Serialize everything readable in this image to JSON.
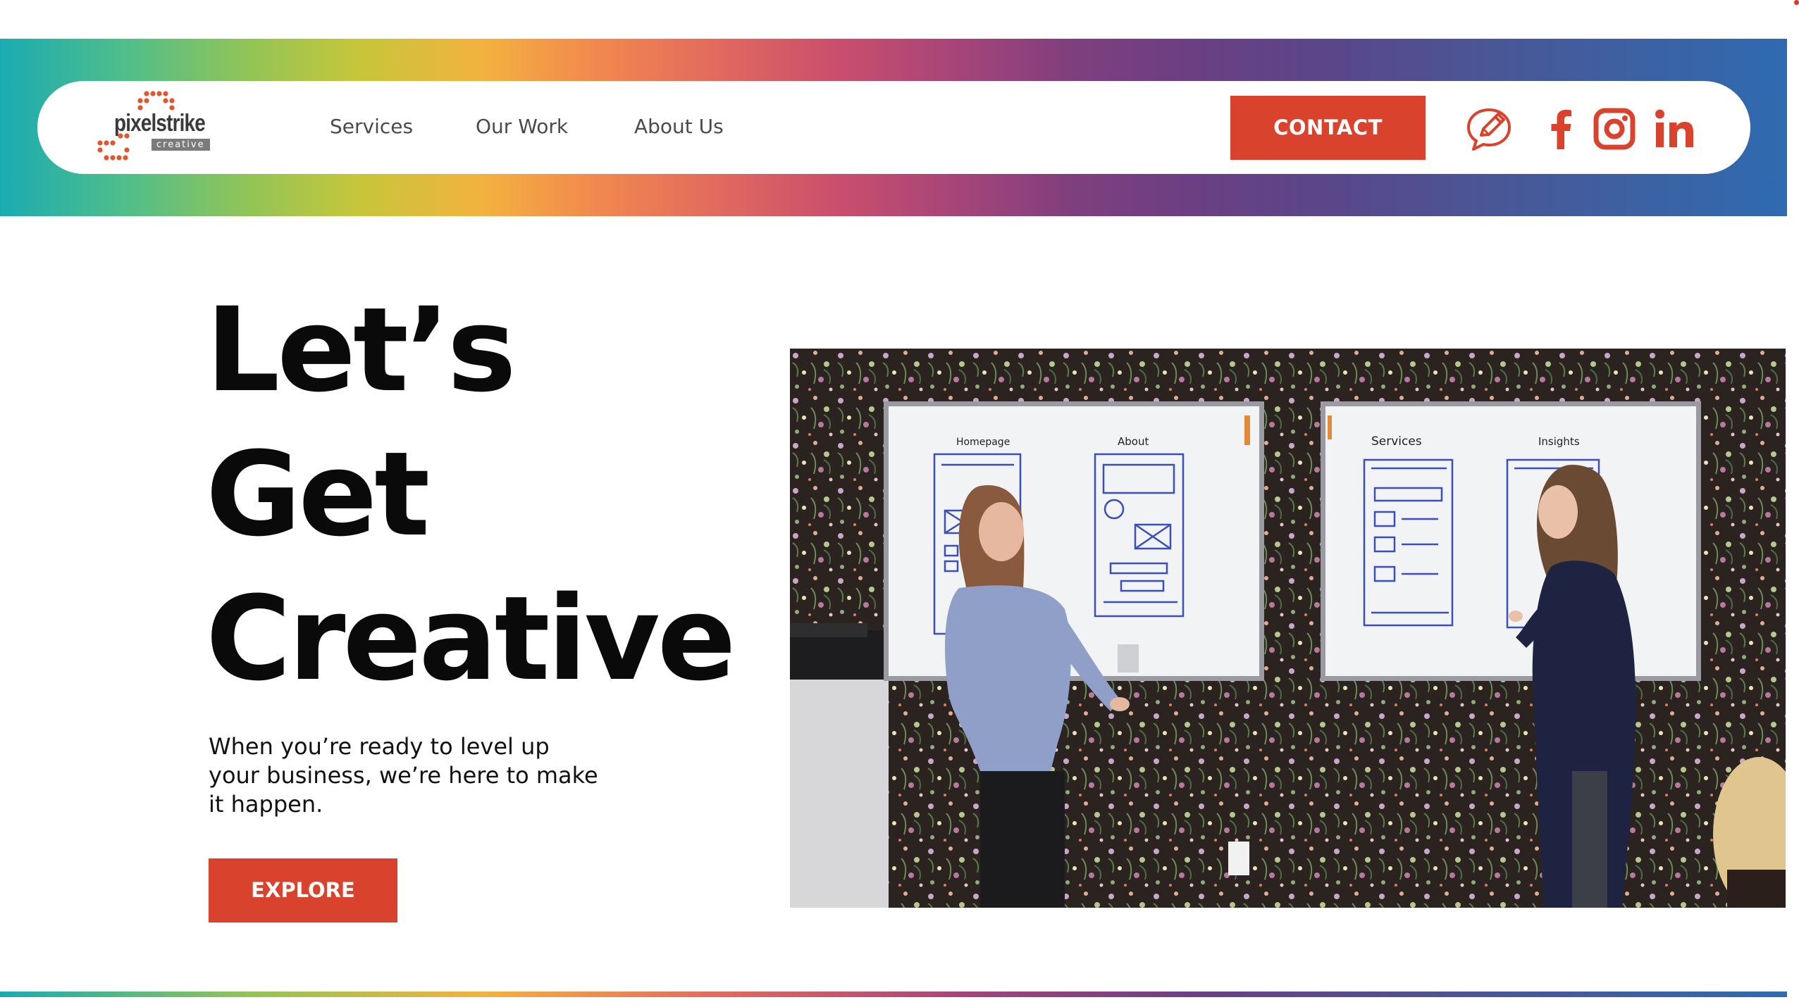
{
  "colors": {
    "accent": "#d9432e",
    "text_dark": "#0a0a0a",
    "nav_text": "#4a4a4a"
  },
  "header": {
    "logo": {
      "name": "pixelstrike",
      "tagline": "creative"
    },
    "nav": [
      {
        "label": "Services"
      },
      {
        "label": "Our Work"
      },
      {
        "label": "About Us"
      }
    ],
    "contact_label": "CONTACT",
    "social_icons": [
      "pencil-chat-icon",
      "facebook-icon",
      "instagram-icon",
      "linkedin-icon"
    ]
  },
  "hero": {
    "title_lines": [
      "Let’s",
      "Get",
      "Creative"
    ],
    "subtitle": "When you’re ready to level up your business, we’re here to make it happen.",
    "cta_label": "EXPLORE",
    "media": {
      "whiteboard_left": {
        "label_1": "Homepage",
        "label_2": "About"
      },
      "whiteboard_right": {
        "label_1": "Services",
        "label_2": "Insights"
      }
    }
  }
}
